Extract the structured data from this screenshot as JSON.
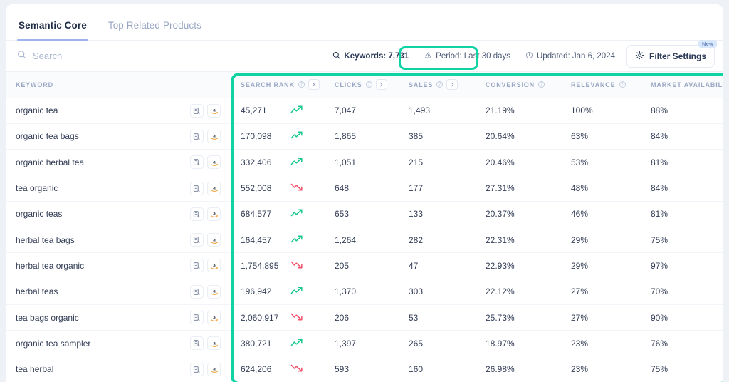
{
  "tabs": [
    {
      "label": "Semantic Core",
      "active": true
    },
    {
      "label": "Top Related Products",
      "active": false
    }
  ],
  "search": {
    "placeholder": "Search",
    "value": "",
    "icon": "search-icon"
  },
  "toolbar": {
    "keywords_label": "Keywords: 7,731",
    "keywords_icon": "search-icon",
    "period_label": "Period: Last 30 days",
    "period_icon": "warning-triangle-icon",
    "updated_label": "Updated: Jan 6, 2024",
    "updated_icon": "clock-icon",
    "filter_label": "Filter Settings",
    "filter_icon": "gear-icon",
    "new_badge": "New"
  },
  "highlight": {
    "color": "#0fd3a3"
  },
  "table": {
    "columns": [
      {
        "label": "KEYWORD",
        "info": false,
        "expand": false
      },
      {
        "label": "SEARCH RANK",
        "info": true,
        "expand": true
      },
      {
        "label": "CLICKS",
        "info": true,
        "expand": true
      },
      {
        "label": "SALES",
        "info": true,
        "expand": true
      },
      {
        "label": "CONVERSION",
        "info": true,
        "expand": false
      },
      {
        "label": "RELEVANCE",
        "info": true,
        "expand": false
      },
      {
        "label": "MARKET AVAILABILITY",
        "info": true,
        "expand": true
      }
    ],
    "rows": [
      {
        "keyword": "organic tea",
        "search_rank": "45,271",
        "trend": "up",
        "clicks": "7,047",
        "sales": "1,493",
        "conversion": "21.19%",
        "relevance": "100%",
        "market_availability": "88%"
      },
      {
        "keyword": "organic tea bags",
        "search_rank": "170,098",
        "trend": "up",
        "clicks": "1,865",
        "sales": "385",
        "conversion": "20.64%",
        "relevance": "63%",
        "market_availability": "84%"
      },
      {
        "keyword": "organic herbal tea",
        "search_rank": "332,406",
        "trend": "up",
        "clicks": "1,051",
        "sales": "215",
        "conversion": "20.46%",
        "relevance": "53%",
        "market_availability": "81%"
      },
      {
        "keyword": "tea organic",
        "search_rank": "552,008",
        "trend": "down",
        "clicks": "648",
        "sales": "177",
        "conversion": "27.31%",
        "relevance": "48%",
        "market_availability": "84%"
      },
      {
        "keyword": "organic teas",
        "search_rank": "684,577",
        "trend": "up",
        "clicks": "653",
        "sales": "133",
        "conversion": "20.37%",
        "relevance": "46%",
        "market_availability": "81%"
      },
      {
        "keyword": "herbal tea bags",
        "search_rank": "164,457",
        "trend": "up",
        "clicks": "1,264",
        "sales": "282",
        "conversion": "22.31%",
        "relevance": "29%",
        "market_availability": "75%"
      },
      {
        "keyword": "herbal tea organic",
        "search_rank": "1,754,895",
        "trend": "down",
        "clicks": "205",
        "sales": "47",
        "conversion": "22.93%",
        "relevance": "29%",
        "market_availability": "97%"
      },
      {
        "keyword": "herbal teas",
        "search_rank": "196,942",
        "trend": "up",
        "clicks": "1,370",
        "sales": "303",
        "conversion": "22.12%",
        "relevance": "27%",
        "market_availability": "70%"
      },
      {
        "keyword": "tea bags organic",
        "search_rank": "2,060,917",
        "trend": "down",
        "clicks": "206",
        "sales": "53",
        "conversion": "25.73%",
        "relevance": "27%",
        "market_availability": "90%"
      },
      {
        "keyword": "organic tea sampler",
        "search_rank": "380,721",
        "trend": "up",
        "clicks": "1,397",
        "sales": "265",
        "conversion": "18.97%",
        "relevance": "23%",
        "market_availability": "76%"
      },
      {
        "keyword": "tea herbal",
        "search_rank": "624,206",
        "trend": "down",
        "clicks": "593",
        "sales": "160",
        "conversion": "26.98%",
        "relevance": "23%",
        "market_availability": "75%"
      }
    ],
    "row_actions": [
      {
        "icon": "keyword-analytics-icon"
      },
      {
        "icon": "amazon-icon"
      }
    ]
  }
}
